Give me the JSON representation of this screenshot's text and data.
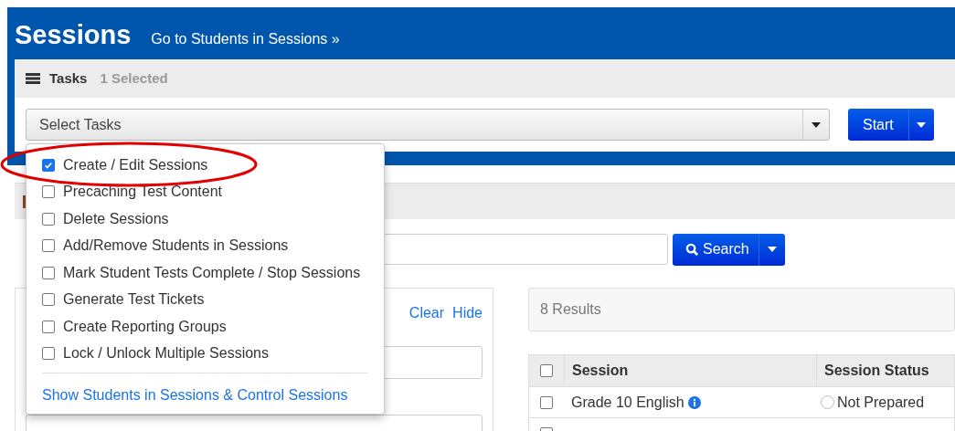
{
  "header": {
    "title": "Sessions",
    "link": "Go to Students in Sessions »"
  },
  "tasks": {
    "title": "Tasks",
    "selected_count": "1 Selected",
    "select": {
      "placeholder": "Select Tasks"
    },
    "start_button": "Start",
    "menu": {
      "items": [
        {
          "label": "Create / Edit Sessions",
          "checked": true,
          "highlighted": true
        },
        {
          "label": "Precaching Test Content",
          "checked": false,
          "highlighted": false
        },
        {
          "label": "Delete Sessions",
          "checked": false,
          "highlighted": false
        },
        {
          "label": "Add/Remove Students in Sessions",
          "checked": false,
          "highlighted": false
        },
        {
          "label": "Mark Student Tests Complete / Stop Sessions",
          "checked": false,
          "highlighted": false
        },
        {
          "label": "Generate Test Tickets",
          "checked": false,
          "highlighted": false
        },
        {
          "label": "Create Reporting Groups",
          "checked": false,
          "highlighted": false
        },
        {
          "label": "Lock / Unlock Multiple Sessions",
          "checked": false,
          "highlighted": false
        }
      ],
      "footer_link": "Show Students in Sessions & Control Sessions"
    }
  },
  "search": {
    "button": "Search"
  },
  "filters": {
    "links": [
      "Clear",
      "Hide"
    ]
  },
  "results": {
    "count": "8 Results",
    "table": {
      "columns": [
        "Session",
        "Session Status"
      ],
      "header_checked": false,
      "rows": [
        {
          "session": "Grade 10 English",
          "status": "Not Prepared",
          "checked": false
        },
        {
          "checked": false
        }
      ]
    }
  }
}
